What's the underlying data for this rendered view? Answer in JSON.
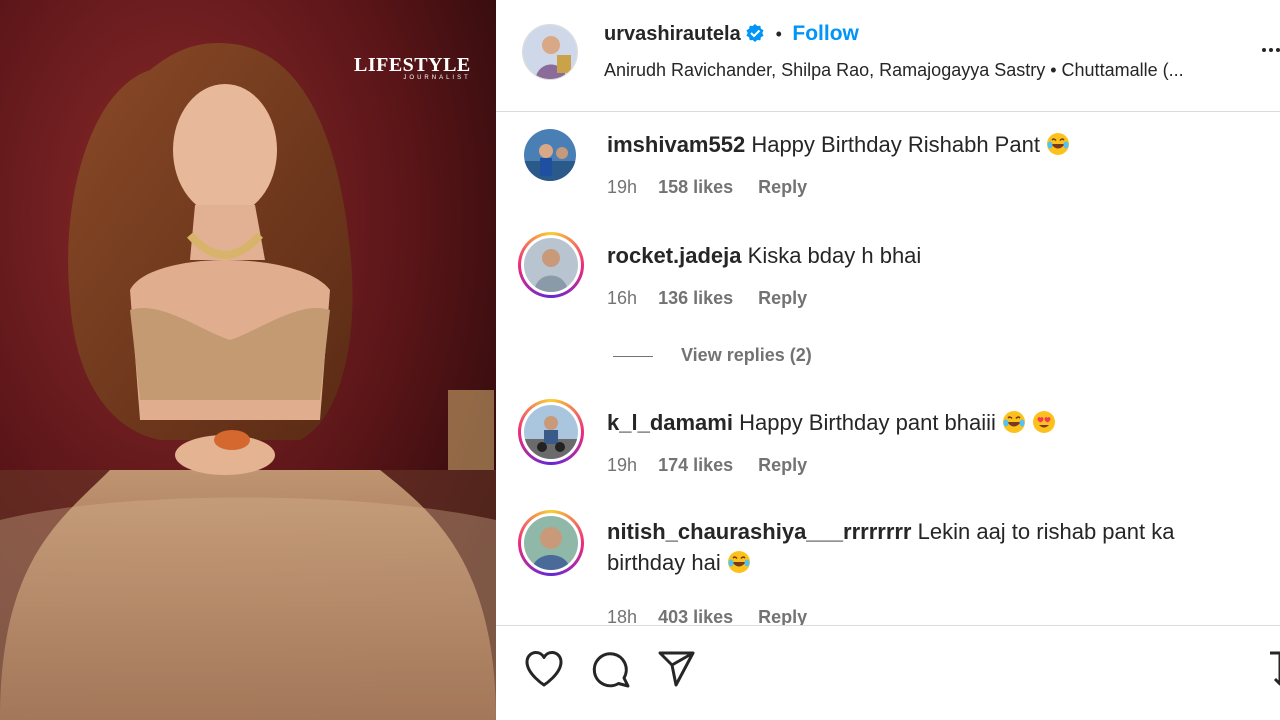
{
  "media": {
    "watermark": "LIFESTYLE",
    "watermark_sub": "JOURNALIST"
  },
  "header": {
    "username": "urvashirautela",
    "separator": "•",
    "follow_label": "Follow",
    "audio": "Anirudh Ravichander, Shilpa Rao, Ramajogayya Sastry • Chuttamalle (..."
  },
  "comments": [
    {
      "user": "imshivam552",
      "text": "Happy Birthday Rishabh Pant",
      "time": "19h",
      "likes": "158 likes",
      "reply": "Reply"
    },
    {
      "user": "rocket.jadeja",
      "text": "Kiska bday h bhai",
      "time": "16h",
      "likes": "136 likes",
      "reply": "Reply",
      "view_replies": "View replies (2)"
    },
    {
      "user": "k_l_damami",
      "text": "Happy Birthday pant bhaiii",
      "time": "19h",
      "likes": "174 likes",
      "reply": "Reply"
    },
    {
      "user": "nitish_chaurashiya___rrrrrrrr",
      "text": "Lekin aaj to rishab pant ka birthday hai",
      "time": "18h",
      "likes": "403 likes",
      "reply": "Reply"
    }
  ],
  "icons": [
    "heart-icon",
    "comment-icon",
    "share-icon",
    "bookmark-icon",
    "more-icon",
    "verified-icon"
  ],
  "colors": {
    "accent": "#0095f6",
    "text": "#262626",
    "muted": "#737373"
  }
}
